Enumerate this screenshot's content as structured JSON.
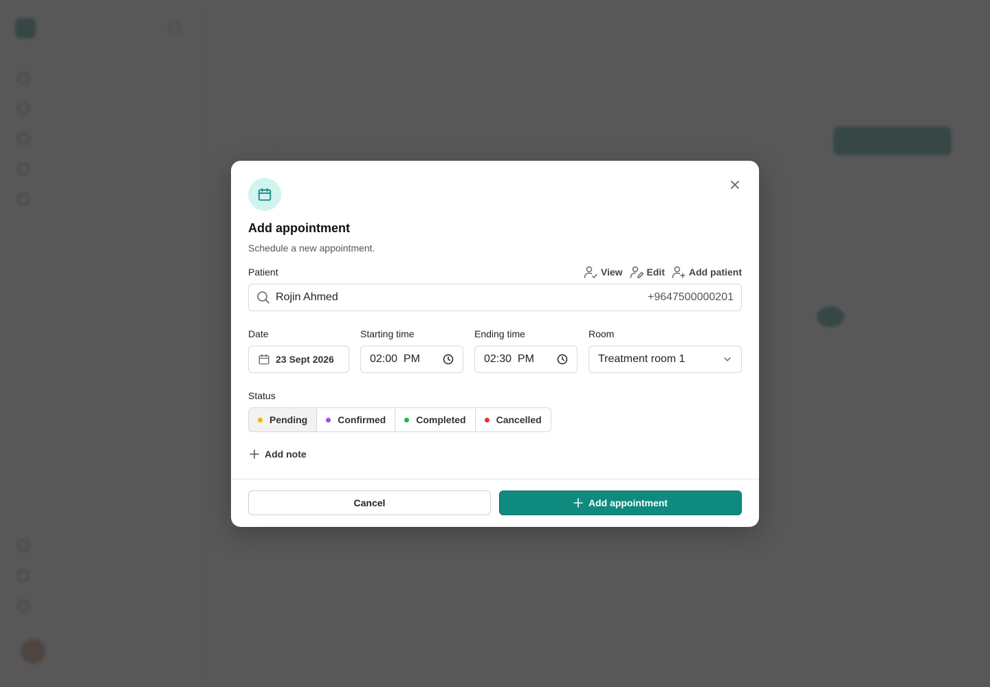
{
  "colors": {
    "accent": "#0f8a7e",
    "icon_bg": "#d2f4ee",
    "pending": "#f0b400",
    "confirmed": "#a448f0",
    "completed": "#18b84a",
    "cancelled": "#ee2b3b"
  },
  "modal": {
    "title": "Add appointment",
    "subtitle": "Schedule a new appointment.",
    "icon": "calendar-icon",
    "patient": {
      "label": "Patient",
      "actions": [
        {
          "label": "View",
          "icon": "user-view-icon"
        },
        {
          "label": "Edit",
          "icon": "user-edit-icon"
        },
        {
          "label": "Add patient",
          "icon": "user-add-icon"
        }
      ],
      "value": "Rojin Ahmed",
      "phone": "+9647500000201"
    },
    "date": {
      "label": "Date",
      "value": "23 Sept 2026"
    },
    "start_time": {
      "label": "Starting time",
      "value": "02:00  PM"
    },
    "end_time": {
      "label": "Ending time",
      "value": "02:30  PM"
    },
    "room": {
      "label": "Room",
      "value": "Treatment room 1"
    },
    "status": {
      "label": "Status",
      "selected": "Pending",
      "options": [
        {
          "label": "Pending"
        },
        {
          "label": "Confirmed"
        },
        {
          "label": "Completed"
        },
        {
          "label": "Cancelled"
        }
      ]
    },
    "add_note_label": "Add note",
    "cancel_label": "Cancel",
    "submit_label": "Add appointment"
  }
}
